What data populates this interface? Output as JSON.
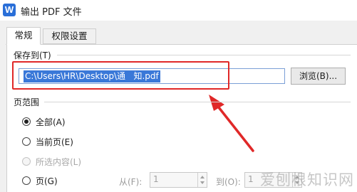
{
  "window": {
    "title": "输出 PDF 文件",
    "app_icon_letter": "W"
  },
  "tabs": [
    {
      "label": "常规",
      "active": true
    },
    {
      "label": "权限设置",
      "active": false
    }
  ],
  "save_to": {
    "group_label": "保存到(T)",
    "path": "C:\\Users\\HR\\Desktop\\通   知.pdf",
    "browse_label": "浏览(B)..."
  },
  "page_range": {
    "group_label": "页范围",
    "options": [
      {
        "label": "全部(A)",
        "checked": true,
        "enabled": true
      },
      {
        "label": "当前页(E)",
        "checked": false,
        "enabled": true
      },
      {
        "label": "所选内容(L)",
        "checked": false,
        "enabled": false
      },
      {
        "label": "页(G)",
        "checked": false,
        "enabled": true
      }
    ],
    "from_label": "从(F):",
    "from_value": "1",
    "to_label": "到(O):",
    "to_value": "1"
  },
  "watermark": "爱刨根知识网",
  "colors": {
    "selection": "#3a78d8",
    "annotation": "#e02828",
    "panel": "#f0f0f0"
  }
}
